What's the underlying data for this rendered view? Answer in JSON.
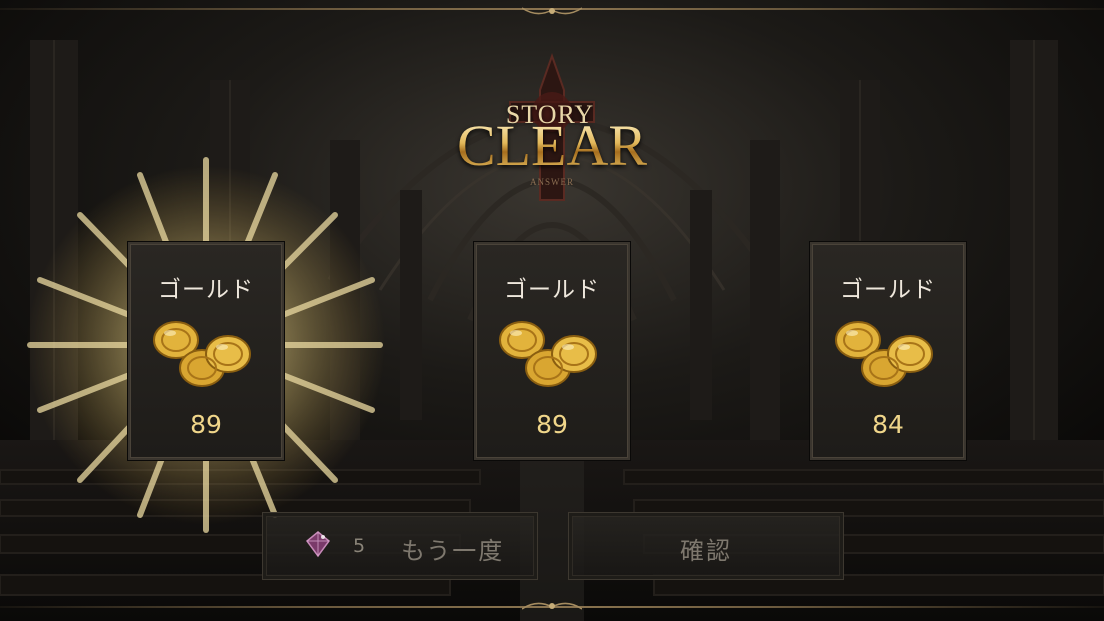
{
  "title": {
    "line1": "STORY",
    "line2": "CLEAR",
    "sub": "ANSWER"
  },
  "rewards": [
    {
      "label": "ゴールド",
      "icon": "gold-coins-icon",
      "value": "89",
      "highlighted": true
    },
    {
      "label": "ゴールド",
      "icon": "gold-coins-icon",
      "value": "89",
      "highlighted": false
    },
    {
      "label": "ゴールド",
      "icon": "gold-coins-icon",
      "value": "84",
      "highlighted": false
    }
  ],
  "buttons": {
    "retry_count": "5",
    "retry_label": "もう一度",
    "retry_icon": "gem-icon",
    "confirm_label": "確認"
  },
  "colors": {
    "gold": "#f0d68a",
    "background": "#0b0908",
    "card_bg": "#24211d"
  }
}
